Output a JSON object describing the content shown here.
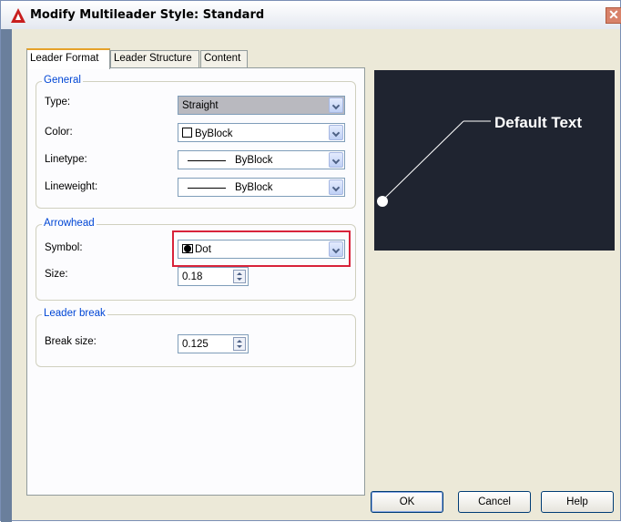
{
  "window": {
    "title": "Modify Multileader Style: Standard",
    "close_glyph": "✕"
  },
  "tabs": [
    {
      "label": "Leader Format",
      "active": true
    },
    {
      "label": "Leader Structure",
      "active": false
    },
    {
      "label": "Content",
      "active": false
    }
  ],
  "general": {
    "legend": "General",
    "type": {
      "label": "Type:",
      "value": "Straight"
    },
    "color": {
      "label": "Color:",
      "value": "ByBlock"
    },
    "linetype": {
      "label": "Linetype:",
      "value": "ByBlock"
    },
    "lineweight": {
      "label": "Lineweight:",
      "value": "ByBlock"
    }
  },
  "arrowhead": {
    "legend": "Arrowhead",
    "symbol": {
      "label": "Symbol:",
      "value": "Dot"
    },
    "size": {
      "label": "Size:",
      "value": "0.18"
    }
  },
  "leader_break": {
    "legend": "Leader break",
    "break_size": {
      "label": "Break size:",
      "value": "0.125"
    }
  },
  "preview": {
    "text": "Default Text",
    "background": "#1f2430"
  },
  "buttons": {
    "ok": "OK",
    "cancel": "Cancel",
    "help": "Help"
  },
  "colors": {
    "highlight": "#d8233a",
    "legend_blue": "#0046d5",
    "active_tab_accent": "#e6a22a"
  }
}
